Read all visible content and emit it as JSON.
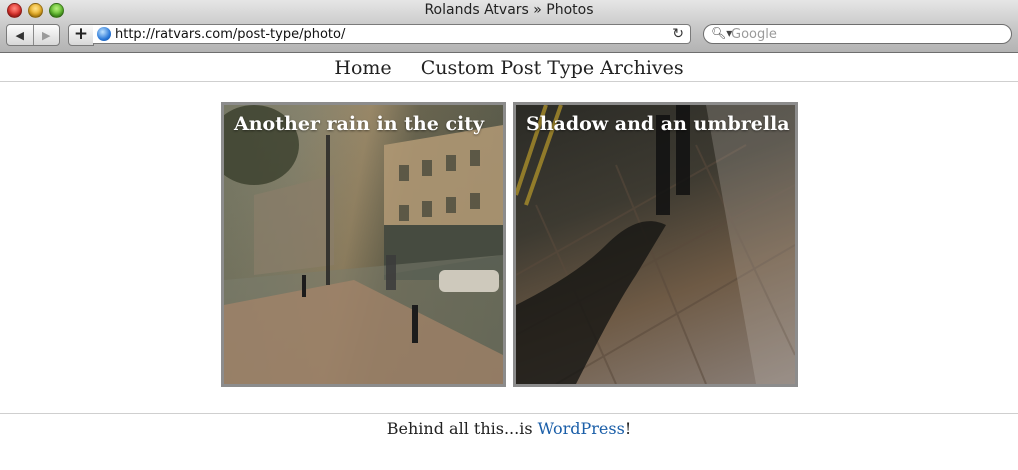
{
  "window": {
    "title": "Rolands Atvars » Photos"
  },
  "toolbar": {
    "back_icon": "back-arrow-icon",
    "forward_icon": "forward-arrow-icon",
    "add_label": "+",
    "url": "http://ratvars.com/post-type/photo/",
    "search_placeholder": "Google"
  },
  "nav": {
    "items": [
      "Home",
      "Custom Post Type Archives"
    ]
  },
  "photos": [
    {
      "title": "Another rain in the city"
    },
    {
      "title": "Shadow and an umbrella"
    }
  ],
  "footer": {
    "prefix": "Behind all this...is ",
    "link": "WordPress",
    "suffix": "!"
  },
  "colors": {
    "link": "#1a5ea8",
    "photo_border": "#8c8c8c"
  }
}
